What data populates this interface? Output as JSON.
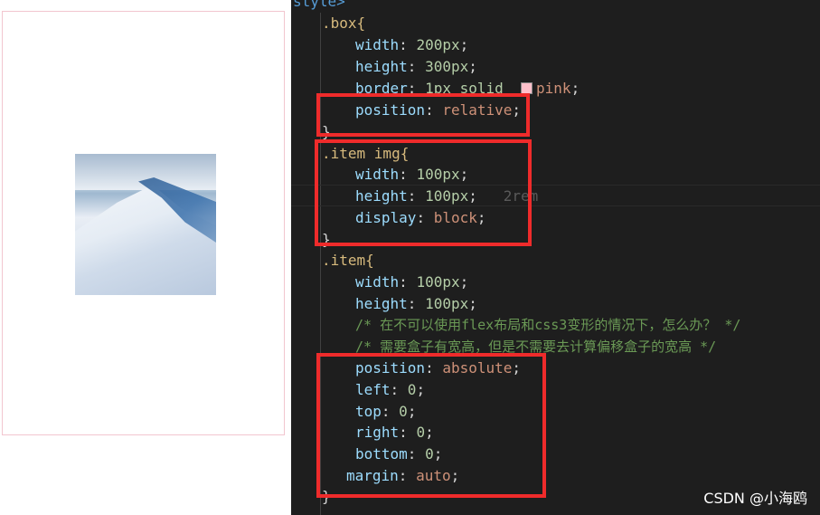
{
  "code_lines": [
    [
      "style>"
    ],
    [
      ".box{"
    ],
    [
      "width",
      "200px"
    ],
    [
      "height",
      "300px"
    ],
    [
      "border",
      "1px solid",
      "pink"
    ],
    [
      "position",
      "relative"
    ],
    [
      "}"
    ],
    [
      ".item img{"
    ],
    [
      "width",
      "100px"
    ],
    [
      "height",
      "100px",
      "2rem"
    ],
    [
      "display",
      "block"
    ],
    [
      "}"
    ],
    [
      ".item{"
    ],
    [
      "width",
      "100px"
    ],
    [
      "height",
      "100px"
    ],
    [
      "/* 在不可以使用flex布局和css3变形的情况下，怎么办？ */"
    ],
    [
      "/* 需要盒子有宽高，但是不需要去计算偏移盒子的宽高 */"
    ],
    [
      "position",
      "absolute"
    ],
    [
      "left",
      "0"
    ],
    [
      "top",
      "0"
    ],
    [
      "right",
      "0"
    ],
    [
      "bottom",
      "0"
    ],
    [
      "margin",
      "auto"
    ],
    [
      "}"
    ]
  ],
  "watermark": "CSDN @小海鸥",
  "colors": {
    "highlight_box": "#ef2b2b",
    "editor_bg": "#1e1e1e",
    "pink_border": "#f2c6cf"
  }
}
